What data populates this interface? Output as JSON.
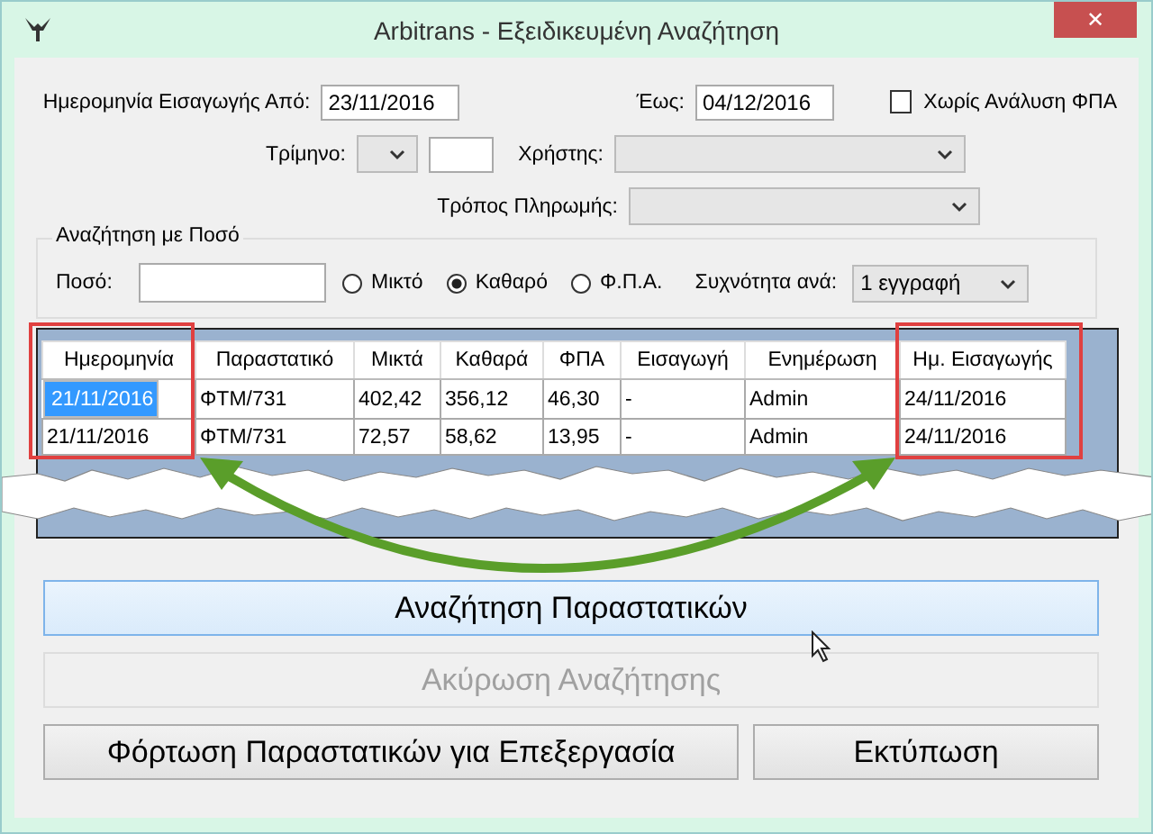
{
  "window": {
    "title": "Arbitrans - Εξειδικευμένη Αναζήτηση",
    "close": "✕"
  },
  "date_from": {
    "label": "Ημερομηνία Εισαγωγής Από:",
    "value": "23/11/2016"
  },
  "date_to": {
    "label": "Έως:",
    "value": "04/12/2016"
  },
  "no_vat_breakdown": {
    "label": "Χωρίς Ανάλυση ΦΠΑ",
    "checked": false
  },
  "quarter": {
    "label": "Τρίμηνο:"
  },
  "user": {
    "label": "Χρήστης:"
  },
  "payment_method": {
    "label": "Τρόπος Πληρωμής:"
  },
  "amount_search": {
    "title": "Αναζήτηση με Ποσό",
    "amount_label": "Ποσό:",
    "options": [
      {
        "label": "Μικτό",
        "selected": false
      },
      {
        "label": "Καθαρό",
        "selected": true
      },
      {
        "label": "Φ.Π.Α.",
        "selected": false
      }
    ],
    "frequency_label": "Συχνότητα ανά:",
    "frequency_value": "1 εγγραφή"
  },
  "table": {
    "columns": [
      "Ημερομηνία",
      "Παραστατικό",
      "Μικτά",
      "Καθαρά",
      "ΦΠΑ",
      "Εισαγωγή",
      "Ενημέρωση",
      "Ημ. Εισαγωγής"
    ],
    "rows": [
      {
        "selected": true,
        "cells": [
          "21/11/2016",
          "ΦΤΜ/731",
          "402,42",
          "356,12",
          "46,30",
          "-",
          "Admin",
          "24/11/2016"
        ]
      },
      {
        "selected": false,
        "cells": [
          "21/11/2016",
          "ΦΤΜ/731",
          "72,57",
          "58,62",
          "13,95",
          "-",
          "Admin",
          "24/11/2016"
        ]
      }
    ]
  },
  "buttons": [
    {
      "label": "Αναζήτηση Παραστατικών",
      "highlighted": true,
      "disabled": false
    },
    {
      "label": "Ακύρωση Αναζήτησης",
      "highlighted": false,
      "disabled": true
    }
  ],
  "bottom_buttons": [
    {
      "label": "Φόρτωση Παραστατικών για Επεξεργασία"
    },
    {
      "label": "Εκτύπωση"
    }
  ]
}
